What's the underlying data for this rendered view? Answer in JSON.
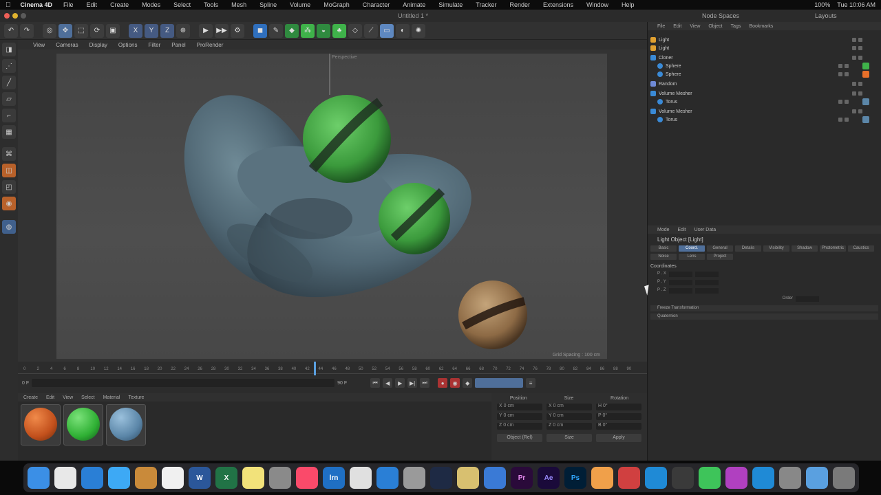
{
  "menubar": {
    "apple": "",
    "app": "Cinema 4D",
    "items": [
      "File",
      "Edit",
      "Create",
      "Modes",
      "Select",
      "Tools",
      "Mesh",
      "Spline",
      "Volume",
      "MoGraph",
      "Character",
      "Animate",
      "Simulate",
      "Tracker",
      "Render",
      "Extensions",
      "Window",
      "Help"
    ],
    "right": [
      "100%",
      "Tue 10:06 AM"
    ]
  },
  "titlebar": {
    "doc": "Untitled 1 *"
  },
  "right_tabs": {
    "a": "Node Spaces",
    "b": "Layouts"
  },
  "viewport": {
    "menu": [
      "View",
      "Cameras",
      "Display",
      "Options",
      "Filter",
      "Panel",
      "ProRender"
    ],
    "label": "Perspective",
    "info": "Grid Spacing : 100 cm"
  },
  "timeline": {
    "ticks": [
      "0",
      "2",
      "4",
      "6",
      "8",
      "10",
      "12",
      "14",
      "16",
      "18",
      "20",
      "22",
      "24",
      "26",
      "28",
      "30",
      "32",
      "34",
      "36",
      "38",
      "40",
      "42",
      "44",
      "46",
      "48",
      "50",
      "52",
      "54",
      "56",
      "58",
      "60",
      "62",
      "64",
      "66",
      "68",
      "70",
      "72",
      "74",
      "76",
      "78",
      "80",
      "82",
      "84",
      "86",
      "88",
      "90"
    ],
    "start": "0 F",
    "end": "90 F"
  },
  "materials": {
    "menu": [
      "Create",
      "Edit",
      "View",
      "Select",
      "Material",
      "Texture"
    ]
  },
  "coords": {
    "headers": [
      "Position",
      "Size",
      "Rotation"
    ],
    "rows": [
      [
        "X 0 cm",
        "X 0 cm",
        "H 0°"
      ],
      [
        "Y 0 cm",
        "Y 0 cm",
        "P 0°"
      ],
      [
        "Z 0 cm",
        "Z 0 cm",
        "B 0°"
      ]
    ],
    "buttons": [
      "Object (Rel)",
      "Size",
      "Apply"
    ]
  },
  "objects": {
    "menu": [
      "File",
      "Edit",
      "View",
      "Object",
      "Tags",
      "Bookmarks"
    ],
    "rows": [
      {
        "name": "Light",
        "color": "#e0a030",
        "ind": "4px"
      },
      {
        "name": "Light",
        "color": "#e0a030",
        "ind": "4px"
      },
      {
        "name": "Cloner",
        "color": "#3a8ad6",
        "ind": "4px"
      },
      {
        "name": "Sphere",
        "color": "#3a8ad6",
        "ind": "14px"
      },
      {
        "name": "Sphere",
        "color": "#3a8ad6",
        "ind": "14px"
      },
      {
        "name": "Random",
        "color": "#6f8ad6",
        "ind": "4px"
      },
      {
        "name": "Volume Mesher",
        "color": "#3a8ad6",
        "ind": "4px"
      },
      {
        "name": "Torus",
        "color": "#3a8ad6",
        "ind": "14px"
      },
      {
        "name": "Volume Mesher",
        "color": "#3a8ad6",
        "ind": "4px"
      },
      {
        "name": "Torus",
        "color": "#3a8ad6",
        "ind": "14px"
      }
    ]
  },
  "attributes": {
    "menu": [
      "Mode",
      "Edit",
      "User Data"
    ],
    "title": "Light Object [Light]",
    "tabs": [
      "Basic",
      "Coord.",
      "General",
      "Details",
      "Visibility",
      "Shadow",
      "Photometric",
      "Caustics",
      "Noise",
      "Lens",
      "Project"
    ],
    "section": "Coordinates",
    "rows": [
      "P . X",
      "P . Y",
      "P . Z"
    ],
    "order": "Order",
    "bars": [
      "Freeze Transformation",
      "Quaternion"
    ]
  },
  "dock": [
    "Finder",
    "Chrome",
    "Safari",
    "Messages",
    "Notes",
    "Calendar",
    "Word",
    "Excel",
    "Stickies",
    "Preview",
    "Music",
    "Lrn",
    "Affinity",
    "Teams",
    "Screen",
    "Cinema4D",
    "Codec",
    "Xcode",
    "Pr",
    "Ae",
    "Ps",
    "Photos",
    "Flux",
    "Edge",
    "OBS",
    "Messages",
    "Light",
    "AppStore",
    "Photo",
    "Folder",
    "Trash"
  ],
  "colors": {
    "accent": "#4f6f9a",
    "green": "#3fb24a",
    "orange": "#e8702a"
  }
}
